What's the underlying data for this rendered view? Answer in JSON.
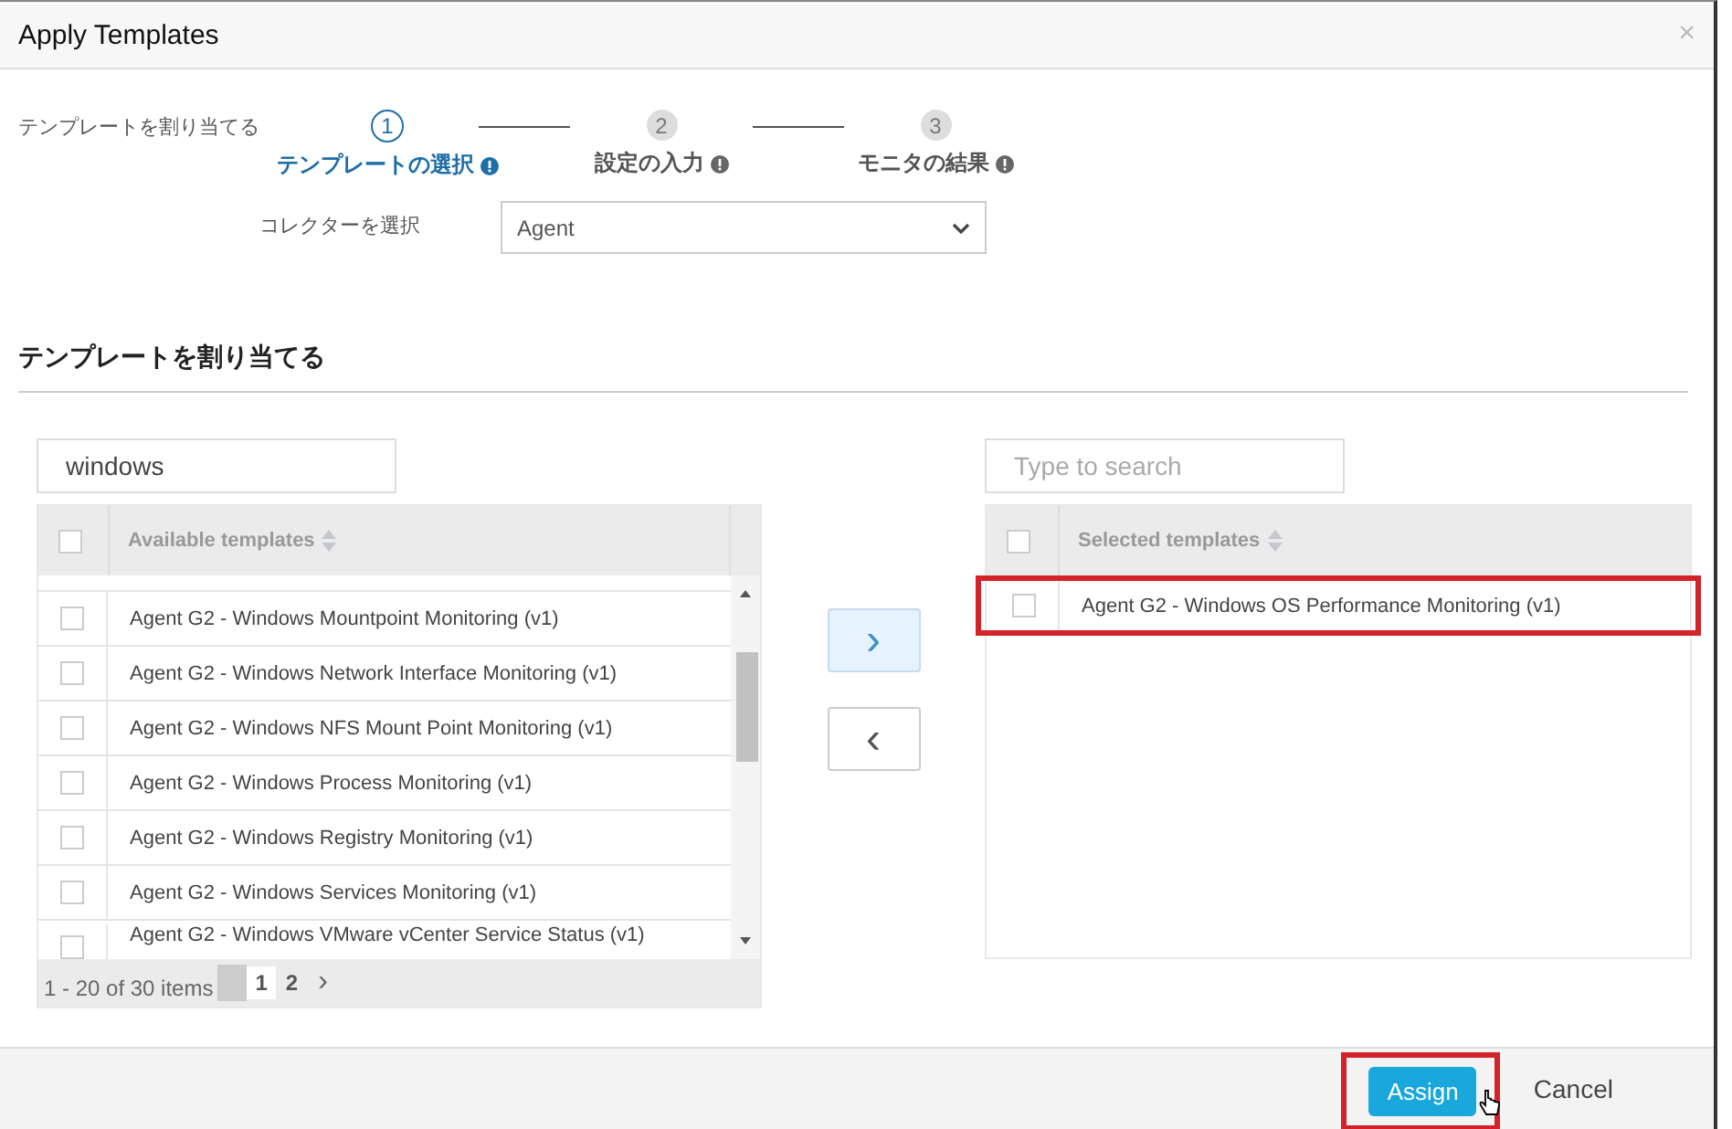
{
  "window": {
    "title": "Apply Templates",
    "close": "×"
  },
  "wizard": {
    "label": "テンプレートを割り当てる",
    "steps": [
      {
        "number": "1",
        "label": "テンプレートの選択",
        "selected": true
      },
      {
        "number": "2",
        "label": "設定の入力",
        "selected": false
      },
      {
        "number": "3",
        "label": "モニタの結果",
        "selected": false
      }
    ],
    "collector": {
      "label": "コレクターを選択",
      "value": "Agent"
    }
  },
  "section_title": "テンプレートを割り当てる",
  "available": {
    "search": {
      "value": "windows"
    },
    "header": "Available templates",
    "all_checked": false,
    "rows": [
      {
        "name": "Agent G2 - Windows Mountpoint Monitoring (v1)",
        "checked": false
      },
      {
        "name": "Agent G2 - Windows Network Interface Monitoring (v1)",
        "checked": false
      },
      {
        "name": "Agent G2 - Windows NFS Mount Point Monitoring (v1)",
        "checked": false
      },
      {
        "name": "Agent G2 - Windows Process Monitoring (v1)",
        "checked": false
      },
      {
        "name": "Agent G2 - Windows Registry Monitoring (v1)",
        "checked": false
      },
      {
        "name": "Agent G2 - Windows Services Monitoring (v1)",
        "checked": false
      },
      {
        "name": "Agent G2 - Windows VMware vCenter Service Status (v1)",
        "checked": false
      }
    ],
    "pager": {
      "summary": "1 - 20 of 30 items",
      "pages": [
        {
          "label": "1",
          "selected": true
        },
        {
          "label": "2",
          "selected": false
        }
      ],
      "next": "›"
    }
  },
  "move_buttons": [
    {
      "label": "›",
      "highlighted": true
    },
    {
      "label": "‹",
      "highlighted": false
    }
  ],
  "selected": {
    "search": {
      "placeholder": "Type to search"
    },
    "header": "Selected templates",
    "all_checked": false,
    "rows": [
      {
        "name": "Agent G2 - Windows OS Performance Monitoring (v1)",
        "checked": false,
        "highlighted": true
      }
    ]
  },
  "footer": {
    "buttons": [
      {
        "label": "Assign",
        "kind": "primary",
        "highlighted": true
      },
      {
        "label": "Cancel",
        "kind": "link",
        "highlighted": false
      }
    ]
  }
}
